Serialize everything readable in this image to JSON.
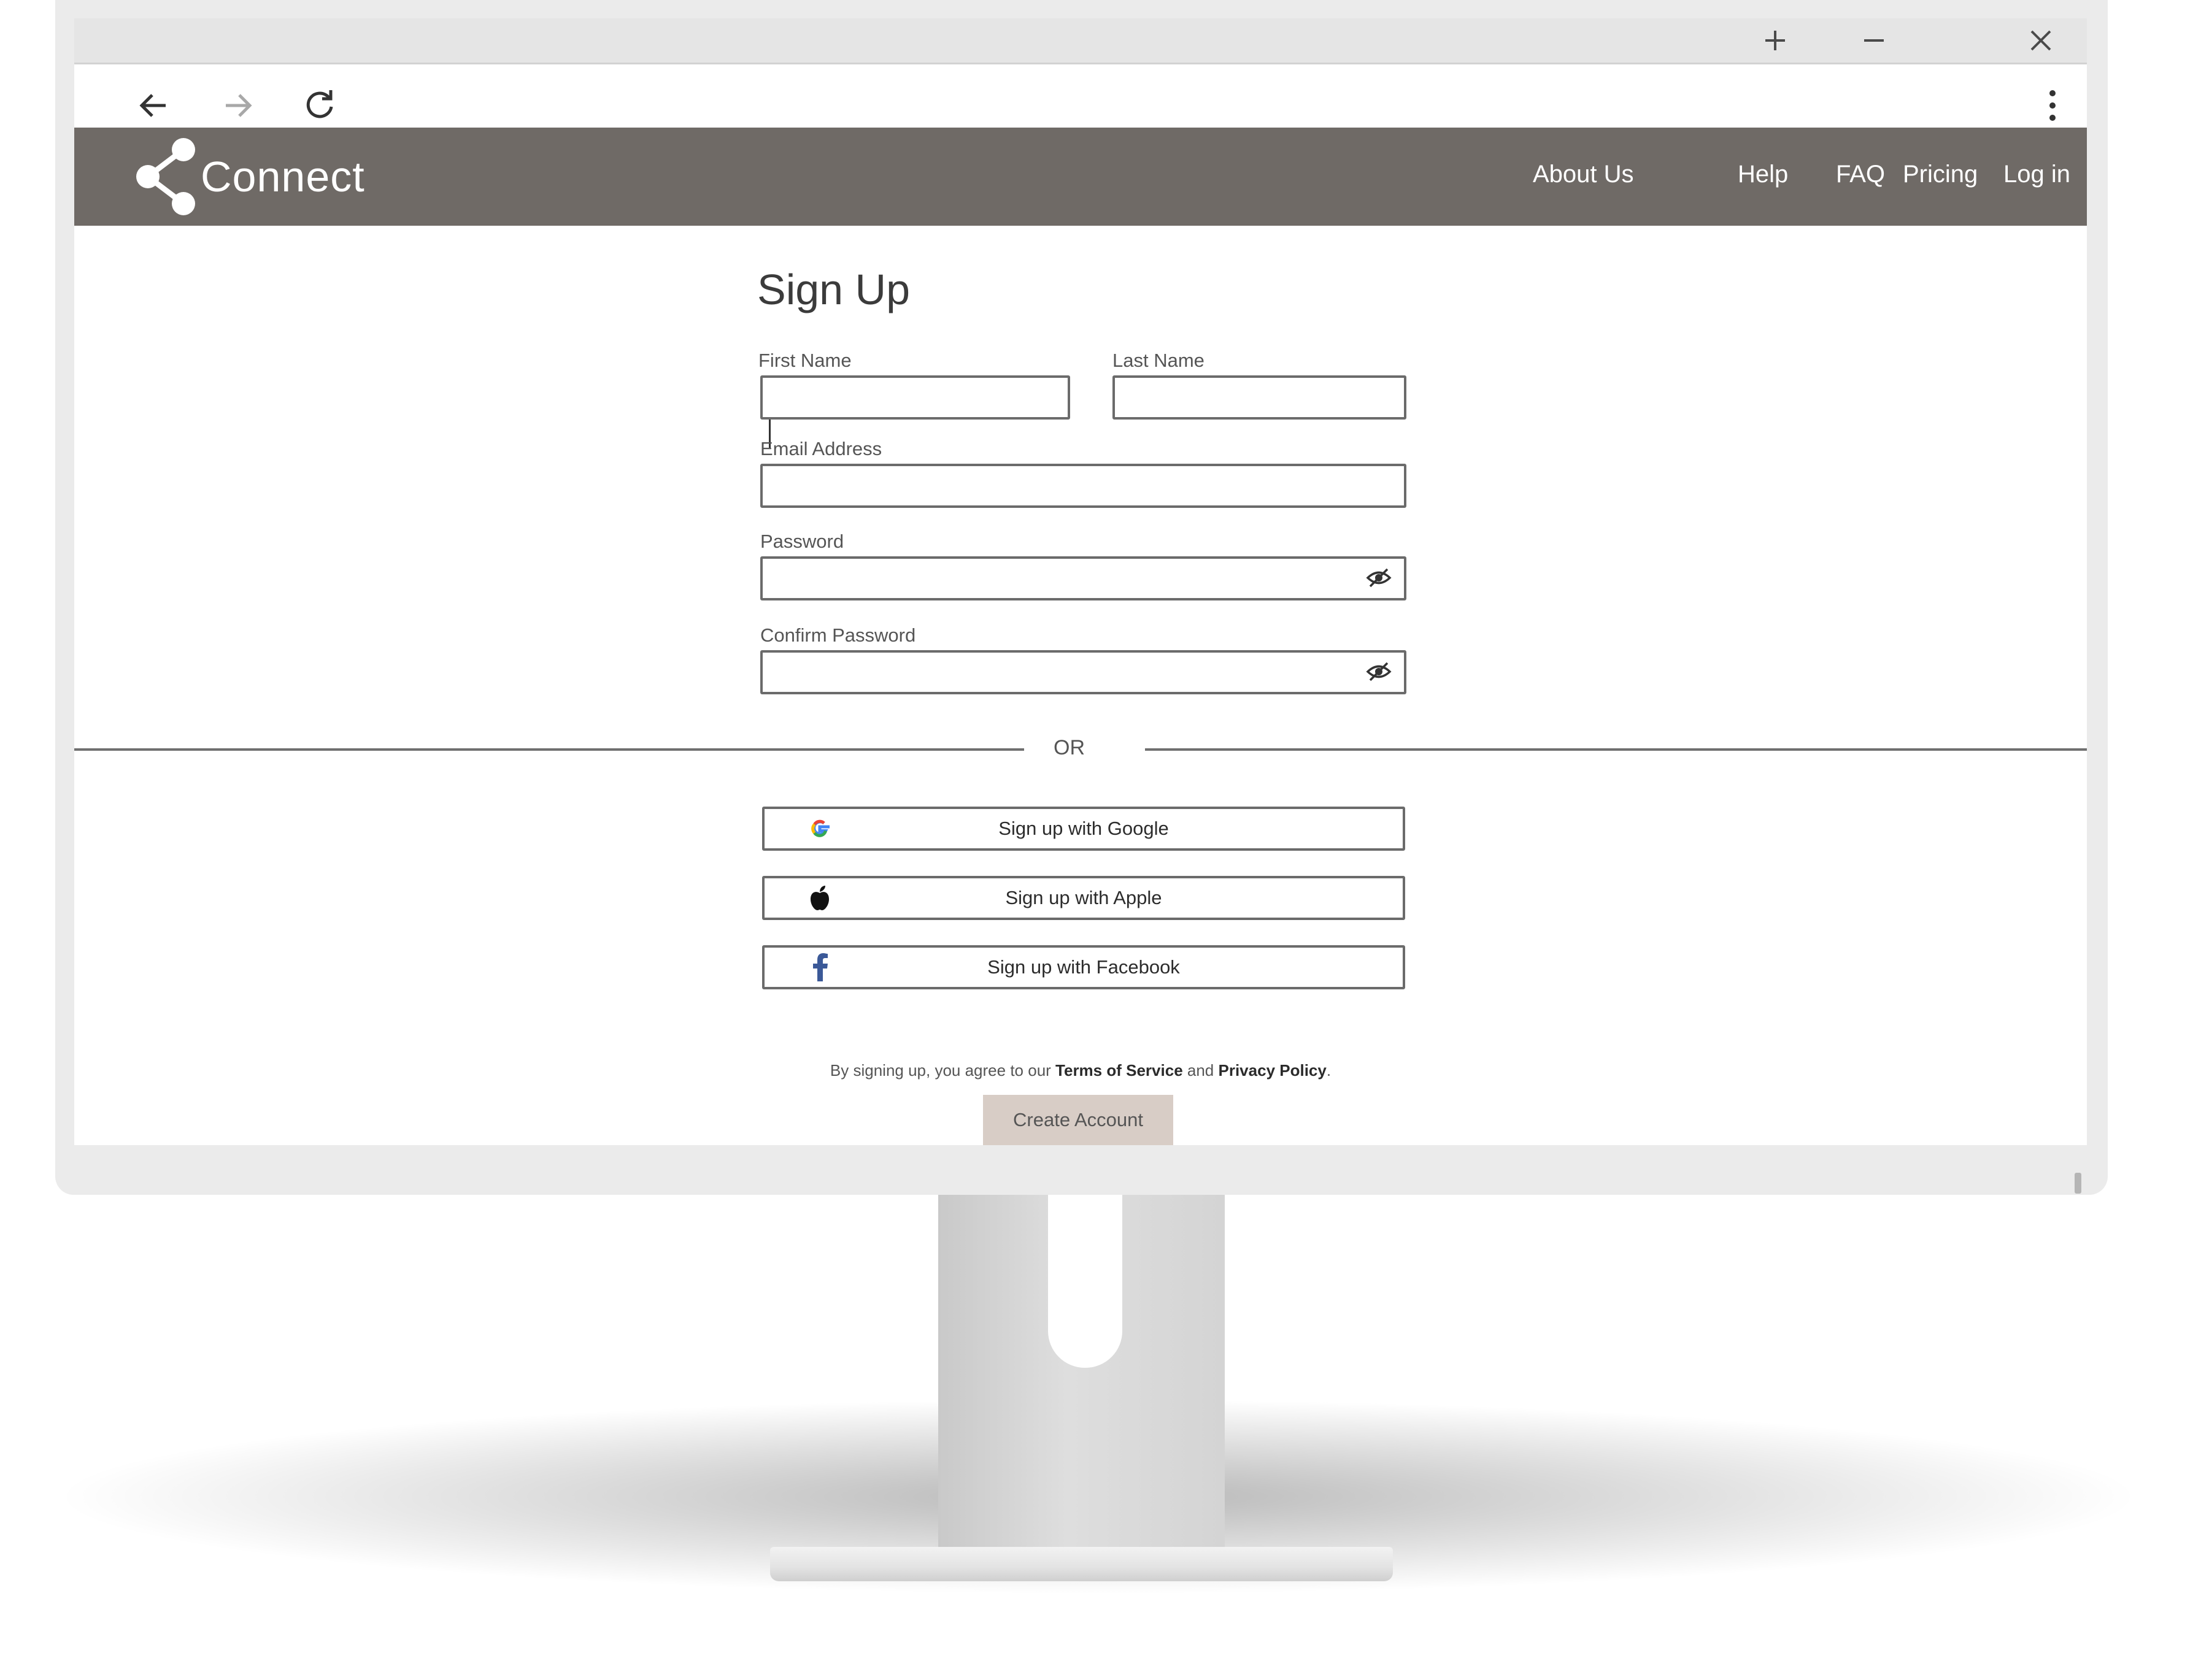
{
  "browser": {
    "window_controls": [
      "new-tab",
      "minimize",
      "close"
    ],
    "nav_icons": [
      "back-arrow-icon",
      "forward-arrow-icon",
      "reload-icon",
      "kebab-menu-icon"
    ]
  },
  "site": {
    "logo_text": "Connect",
    "nav": [
      "About Us",
      "Help",
      "FAQ",
      "Pricing",
      "Log in"
    ],
    "header_color": "#6f6a66"
  },
  "form": {
    "title": "Sign Up",
    "first_name_label": "First Name",
    "last_name_label": "Last Name",
    "email_label": "Email Address",
    "password_label": "Password",
    "confirm_password_label": "Confirm Password",
    "first_name_value": "",
    "last_name_value": "",
    "email_value": "",
    "password_value": "",
    "confirm_password_value": ""
  },
  "divider_text": "OR",
  "social": {
    "google": "Sign up with Google",
    "apple": "Sign up with Apple",
    "facebook": "Sign up with Facebook"
  },
  "terms": {
    "prefix": "By signing up, you agree to our ",
    "tos": "Terms of Service",
    "and": "and ",
    "privacy": "Privacy Policy",
    "suffix": "."
  },
  "create_button": "Create Account",
  "colors": {
    "create_button_bg": "#d8cdc6",
    "facebook_blue": "#3b5998"
  }
}
